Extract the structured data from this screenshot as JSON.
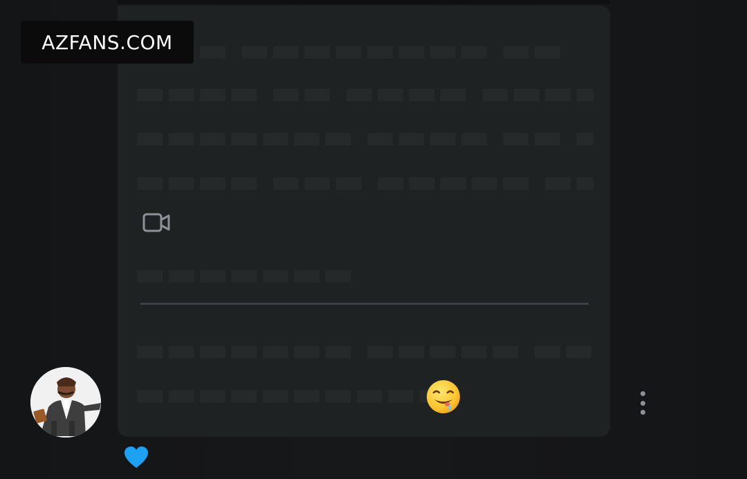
{
  "watermark": {
    "text": "AZFANS.COM"
  },
  "icons": {
    "video": "video-camera-icon",
    "emoji": "drooling-face-emoji",
    "more": "more-vertical-icon",
    "heart": "heart-icon",
    "avatar": "user-avatar"
  },
  "colors": {
    "background": "#151617",
    "card": "#1f2223",
    "divider": "#3d4046",
    "heart": "#1da1f2",
    "icon_gray": "#8e9297",
    "watermark_bg": "#0b0b0c"
  }
}
